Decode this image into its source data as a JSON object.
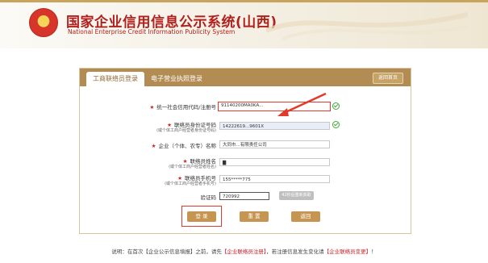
{
  "header": {
    "title": "国家企业信用信息公示系统(山西)",
    "subtitle": "National Enterprise Credit Information Publicity System",
    "brand_color": "#b2201d"
  },
  "tabs": {
    "active": "工商联络员登录",
    "inactive": "电子营业执照登录",
    "back_home": "返回首页"
  },
  "form": {
    "credit_code": {
      "label": "统一社会信用代码/注册号",
      "value": "91140200MA0KA..."
    },
    "liaison_id": {
      "label": "联络员身份证号码",
      "hint": "(或个体工商户经营者身份证号码)",
      "value": "14222619...9601X"
    },
    "company_name": {
      "label": "企业（个体、农专）名称",
      "value": "大同市...有限责任公司"
    },
    "liaison_name": {
      "label": "联络员姓名",
      "hint": "(或个体工商户经营者姓名)",
      "value": "▇"
    },
    "liaison_phone": {
      "label": "联络员手机号",
      "hint": "(或个体工商户经营者手机号)",
      "value": "155*****775"
    },
    "captcha": {
      "label": "验证码",
      "value": "720992",
      "sms_button": "42秒后重新获取"
    }
  },
  "buttons": {
    "login": "登 录",
    "reset": "重 置",
    "back": "返回"
  },
  "footer": {
    "prefix": "说明：在首次【企业公示信息填报】之前，请先",
    "link1": "【企业联络员注册】",
    "middle": "，若注册信息发生变化请",
    "link2": "【企业联络员变更】",
    "suffix": "！"
  },
  "colors": {
    "accent": "#b28c52",
    "highlight_red": "#e23a2a",
    "check_green": "#46a83a"
  }
}
